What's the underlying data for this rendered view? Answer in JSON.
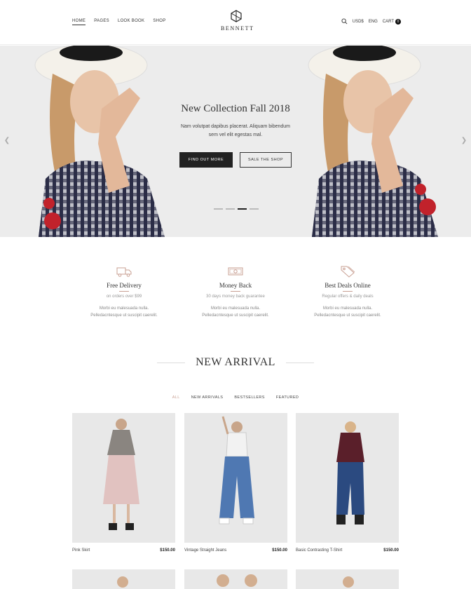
{
  "header": {
    "nav": [
      "HOME",
      "PAGES",
      "LOOK BOOK",
      "SHOP"
    ],
    "logo_text": "BENNETT",
    "currency": "USD$",
    "language": "ENG",
    "cart_label": "CART",
    "cart_count": "0"
  },
  "hero": {
    "title": "New Collection Fall 2018",
    "text_line1": "Nam volutpat dapibus placerat. Aliquam bibendum",
    "text_line2": "sem vel elit egestas mal.",
    "primary_button": "FIND OUT MORE",
    "secondary_button": "SALE THE SHOP",
    "slide_count": 4,
    "active_slide": 3
  },
  "features": [
    {
      "icon": "truck-icon",
      "title": "Free Delivery",
      "subtitle": "on orders over $99",
      "desc1": "Morbi eu malesuada nulla.",
      "desc2": "Pelledacntesque ut suscipit caerelit."
    },
    {
      "icon": "money-icon",
      "title": "Money Back",
      "subtitle": "30 days money back guarantee",
      "desc1": "Morbi eu malesuada nulla.",
      "desc2": "Pelledacntesque ut suscipit caerelit."
    },
    {
      "icon": "tag-icon",
      "title": "Best Deals Online",
      "subtitle": "Regular offers & daily deals",
      "desc1": "Morbi eu malesuada nulla.",
      "desc2": "Pelledacntesque ut suscipit caerelit."
    }
  ],
  "section": {
    "title": "NEW ARRIVAL",
    "filters": [
      "ALL",
      "NEW ARRIVALS",
      "BESTSELLERS",
      "FEATURED"
    ]
  },
  "products": [
    {
      "name": "Pink Skirt",
      "price": "$150.00"
    },
    {
      "name": "Vintage Straight Jeans",
      "price": "$150.00"
    },
    {
      "name": "Basic Contrasting T-Shirt",
      "price": "$150.00"
    }
  ],
  "colors": {
    "accent": "#c9a093",
    "dark": "#222222",
    "hero_bg": "#ececec"
  }
}
